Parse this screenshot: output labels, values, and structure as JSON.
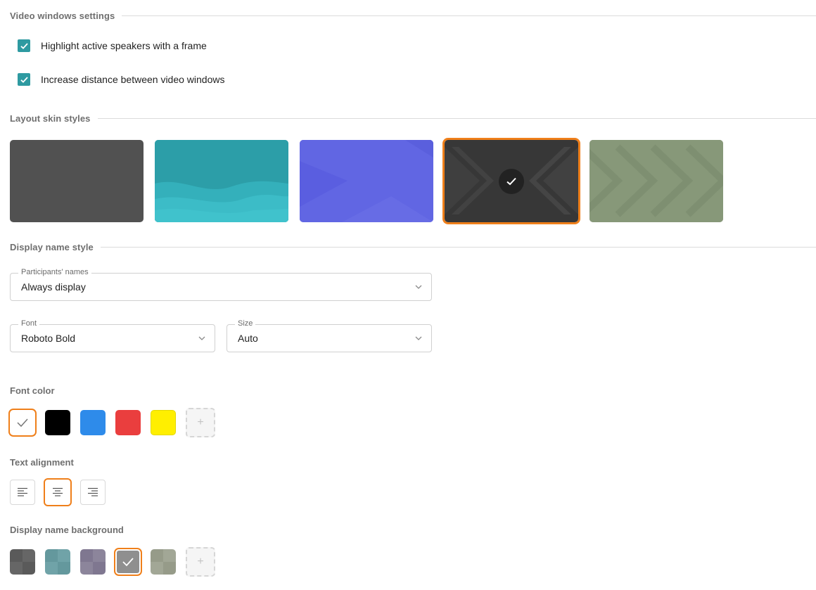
{
  "sections": {
    "video_windows": "Video windows settings",
    "layout_skins": "Layout skin styles",
    "display_name_style": "Display name style"
  },
  "checkboxes": [
    {
      "label": "Highlight active speakers with a frame",
      "checked": true
    },
    {
      "label": "Increase distance between video windows",
      "checked": true
    }
  ],
  "skins": [
    {
      "name": "dark-gray",
      "color": "#515151",
      "selected": false
    },
    {
      "name": "teal-waves",
      "color": "#30a8b3",
      "selected": false
    },
    {
      "name": "purple-geometric",
      "color": "#6366e4",
      "selected": false
    },
    {
      "name": "dark-chevrons",
      "color": "#3a3a3a",
      "selected": true
    },
    {
      "name": "olive-chevrons",
      "color": "#87977a",
      "selected": false
    }
  ],
  "participants_names": {
    "legend": "Participants' names",
    "value": "Always display"
  },
  "font_select": {
    "legend": "Font",
    "value": "Roboto Bold"
  },
  "size_select": {
    "legend": "Size",
    "value": "Auto"
  },
  "font_color": {
    "label": "Font color",
    "colors": [
      "#ffffff",
      "#000000",
      "#2e8bea",
      "#ea3e3e",
      "#ffef00"
    ],
    "selected_index": 0,
    "add_symbol": "+"
  },
  "text_alignment": {
    "label": "Text alignment",
    "options": [
      "left",
      "center",
      "right"
    ],
    "selected": "center"
  },
  "name_background": {
    "label": "Display name background",
    "colors": [
      "#5c5c5c",
      "#6a9ba0",
      "#857d94",
      "#8f8f8f",
      "#9ba08e"
    ],
    "selected_index": 3,
    "add_symbol": "+"
  }
}
